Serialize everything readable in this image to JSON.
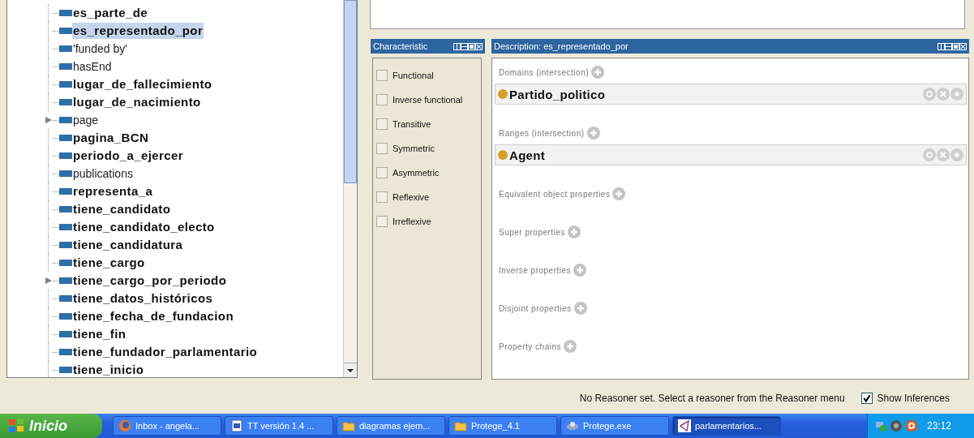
{
  "property_tree": {
    "items": [
      {
        "label": "es_parte_de",
        "bold": true,
        "selected": false,
        "expandable": false
      },
      {
        "label": "es_representado_por",
        "bold": true,
        "selected": true,
        "expandable": false
      },
      {
        "label": "'funded by'",
        "bold": false,
        "selected": false,
        "expandable": false
      },
      {
        "label": "hasEnd",
        "bold": false,
        "selected": false,
        "expandable": false
      },
      {
        "label": "lugar_de_fallecimiento",
        "bold": true,
        "selected": false,
        "expandable": false
      },
      {
        "label": "lugar_de_nacimiento",
        "bold": true,
        "selected": false,
        "expandable": false
      },
      {
        "label": "page",
        "bold": false,
        "selected": false,
        "expandable": true
      },
      {
        "label": "pagina_BCN",
        "bold": true,
        "selected": false,
        "expandable": false
      },
      {
        "label": "periodo_a_ejercer",
        "bold": true,
        "selected": false,
        "expandable": false
      },
      {
        "label": "publications",
        "bold": false,
        "selected": false,
        "expandable": false
      },
      {
        "label": "representa_a",
        "bold": true,
        "selected": false,
        "expandable": false
      },
      {
        "label": "tiene_candidato",
        "bold": true,
        "selected": false,
        "expandable": false
      },
      {
        "label": "tiene_candidato_electo",
        "bold": true,
        "selected": false,
        "expandable": false
      },
      {
        "label": "tiene_candidatura",
        "bold": true,
        "selected": false,
        "expandable": false
      },
      {
        "label": "tiene_cargo",
        "bold": true,
        "selected": false,
        "expandable": false
      },
      {
        "label": "tiene_cargo_por_periodo",
        "bold": true,
        "selected": false,
        "expandable": true
      },
      {
        "label": "tiene_datos_históricos",
        "bold": true,
        "selected": false,
        "expandable": false
      },
      {
        "label": "tiene_fecha_de_fundacion",
        "bold": true,
        "selected": false,
        "expandable": false
      },
      {
        "label": "tiene_fin",
        "bold": true,
        "selected": false,
        "expandable": false
      },
      {
        "label": "tiene_fundador_parlamentario",
        "bold": true,
        "selected": false,
        "expandable": false
      },
      {
        "label": "tiene_inicio",
        "bold": true,
        "selected": false,
        "expandable": false
      }
    ]
  },
  "characteristics": {
    "title": "Characteristic",
    "items": [
      {
        "label": "Functional",
        "checked": false
      },
      {
        "label": "Inverse functional",
        "checked": false
      },
      {
        "label": "Transitive",
        "checked": false
      },
      {
        "label": "Symmetric",
        "checked": false
      },
      {
        "label": "Asymmetric",
        "checked": false
      },
      {
        "label": "Reflexive",
        "checked": false
      },
      {
        "label": "Irreflexive",
        "checked": false
      }
    ]
  },
  "description": {
    "title": "Description: es_representado_por",
    "sections": [
      {
        "label": "Domains (intersection)",
        "entries": [
          "Partido_politico"
        ]
      },
      {
        "label": "Ranges (intersection)",
        "entries": [
          "Agent"
        ]
      },
      {
        "label": "Equivalent object properties"
      },
      {
        "label": "Super properties"
      },
      {
        "label": "Inverse properties"
      },
      {
        "label": "Disjoint properties"
      },
      {
        "label": "Property chains"
      }
    ]
  },
  "status_bar": {
    "message": "No Reasoner set. Select a reasoner from the Reasoner menu",
    "show_inferences": {
      "label": "Show Inferences",
      "checked": true
    }
  },
  "taskbar": {
    "start": "Inicio",
    "buttons": [
      {
        "label": "Inbox - angela...",
        "kind": "browser",
        "selected": false
      },
      {
        "label": "TT versión 1.4 ...",
        "kind": "document",
        "selected": false
      },
      {
        "label": "diagramas ejem...",
        "kind": "folder",
        "selected": false
      },
      {
        "label": "Protege_4.1",
        "kind": "folder",
        "selected": false
      },
      {
        "label": "Protege.exe",
        "kind": "program",
        "selected": false
      },
      {
        "label": "parlamentarios...",
        "kind": "ontology",
        "selected": true
      }
    ],
    "clock": "23:12"
  }
}
